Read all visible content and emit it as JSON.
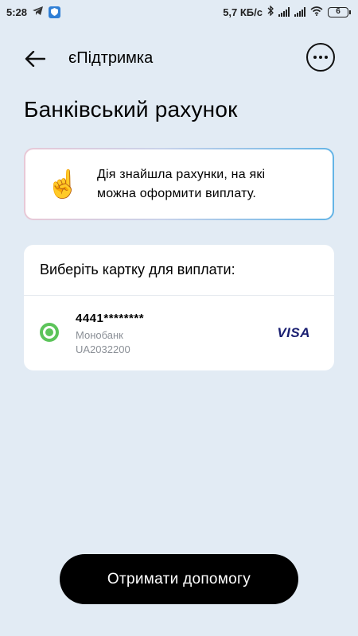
{
  "status_bar": {
    "time": "5:28",
    "net_speed": "5,7 КБ/с",
    "battery": "6"
  },
  "header": {
    "title": "єПідтримка"
  },
  "page_title": "Банківський рахунок",
  "notice": {
    "emoji": "☝️",
    "line1": "Дія знайшла рахунки, на які",
    "line2": "можна оформити виплату."
  },
  "cards": {
    "heading": "Виберіть картку для виплати:",
    "items": [
      {
        "number": "4441********",
        "bank": "Монобанк",
        "iban": "UA2032200",
        "network": "VISA",
        "selected": true
      }
    ]
  },
  "help_button": "Отримати допомогу",
  "colors": {
    "background": "#e2ebf4",
    "radio_selected": "#5cc45a",
    "visa": "#1a1f71"
  }
}
